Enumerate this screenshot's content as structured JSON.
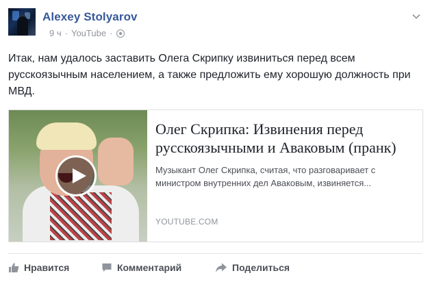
{
  "post": {
    "author": "Alexey Stolyarov",
    "time": "9 ч",
    "source": "YouTube",
    "text": "Итак, нам удалось заставить Олега Скрипку извиниться перед всем русскоязычным населением, а также предложить ему хорошую должность при МВД."
  },
  "link_card": {
    "title": "Олег Скрипка: Извинения перед русскоязычными и Аваковым (пранк)",
    "description": "Музыкант Олег Скрипка, считая, что разговаривает с министром внутренних дел Аваковым, извиняется...",
    "domain": "YOUTUBE.COM"
  },
  "actions": {
    "like": "Нравится",
    "comment": "Комментарий",
    "share": "Поделиться"
  },
  "icons": {
    "privacy": "globe-icon",
    "menu": "chevron-down-icon",
    "video": "play-icon",
    "like": "thumbs-up-icon",
    "comment": "comment-icon",
    "share": "share-arrow-icon"
  },
  "colors": {
    "author_link": "#365899",
    "meta_text": "#90949c",
    "action_text": "#4b4f56"
  }
}
